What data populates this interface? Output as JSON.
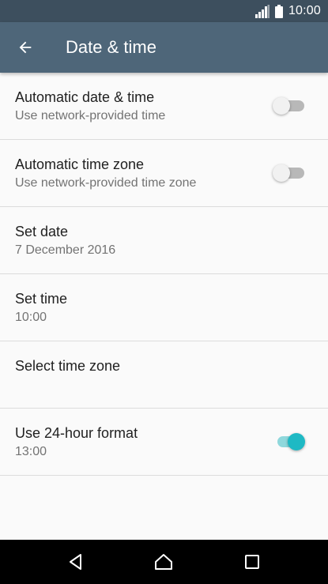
{
  "status_bar": {
    "time": "10:00",
    "battery_icon": "battery-full-icon",
    "signal_icon": "signal-icon"
  },
  "app_bar": {
    "title": "Date & time",
    "back_icon": "arrow-back-icon"
  },
  "settings": [
    {
      "title": "Automatic date & time",
      "subtitle": "Use network-provided time",
      "switch_on": false
    },
    {
      "title": "Automatic time zone",
      "subtitle": "Use network-provided time zone",
      "switch_on": false
    },
    {
      "title": "Set date",
      "subtitle": "7 December 2016"
    },
    {
      "title": "Set time",
      "subtitle": "10:00"
    },
    {
      "title": "Select time zone",
      "subtitle": ""
    },
    {
      "title": "Use 24-hour format",
      "subtitle": "13:00",
      "switch_on": true
    }
  ],
  "nav_bar": {
    "back_icon": "nav-back-icon",
    "home_icon": "nav-home-icon",
    "recents_icon": "nav-recents-icon"
  },
  "colors": {
    "status_bar": "#3d4f5e",
    "app_bar": "#4e6679",
    "accent": "#1eb9c4",
    "background": "#fafafa"
  }
}
